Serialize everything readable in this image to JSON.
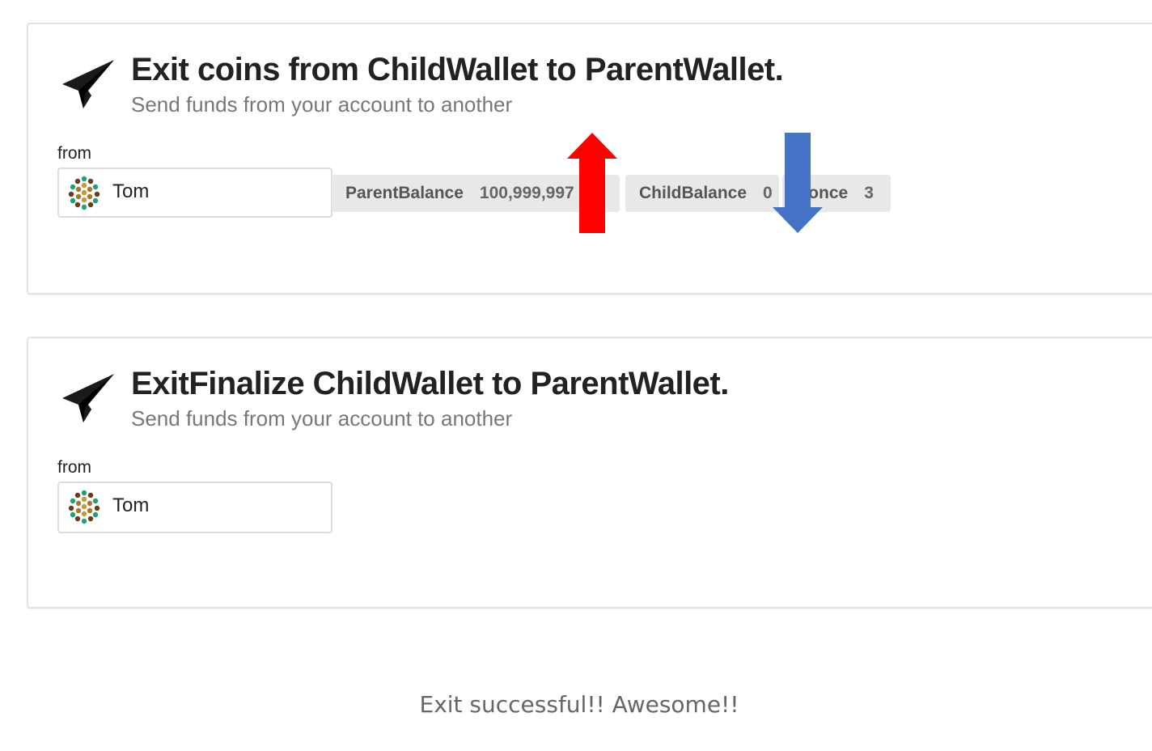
{
  "exit_card": {
    "title": "Exit coins from ChildWallet to ParentWallet.",
    "subtitle": "Send funds from your account to another",
    "from_label": "from",
    "account_name": "Tom",
    "badges": {
      "parent_label": "ParentBalance",
      "parent_value": "100,999,997 u",
      "child_label": "ChildBalance",
      "child_value": "0",
      "nonce_label": "Nonce",
      "nonce_value": "3"
    },
    "arrows": {
      "up_color": "#ff0000",
      "down_color": "#4472c4"
    }
  },
  "finalize_card": {
    "title": "ExitFinalize ChildWallet to ParentWallet.",
    "subtitle": "Send funds from your account to another",
    "from_label": "from",
    "account_name": "Tom"
  },
  "status_message": "Exit successful!! Awesome!!",
  "icons": {
    "send": "paper-plane-icon",
    "avatar": "identicon-avatar"
  }
}
